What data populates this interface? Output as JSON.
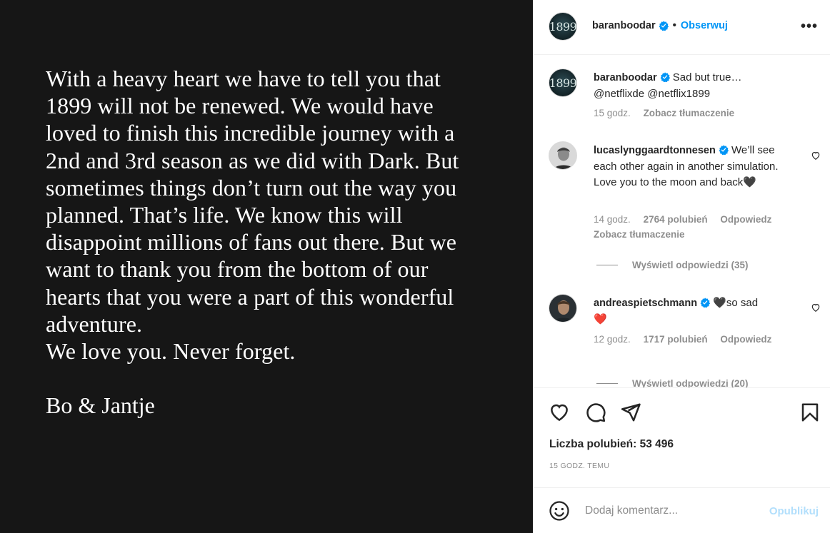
{
  "post": {
    "letter_lines": [
      "With a heavy heart we have to tell you that",
      "1899 will not be renewed. We would have",
      "loved to finish this incredible journey with a",
      "2nd and 3rd season as we did with Dark. But",
      "sometimes things don’t turn out the way you",
      "planned. That’s life. We know this will",
      "disappoint millions of fans out there. But we",
      "want to thank you from the bottom of our",
      "hearts that you were a part of this wonderful",
      "adventure.",
      "We love you. Never forget."
    ],
    "signature": "Bo & Jantje"
  },
  "header": {
    "avatar_text": "1899",
    "username": "baranboodar",
    "follow_label": "Obserwuj",
    "separator": "•",
    "more_label": "•••"
  },
  "caption": {
    "username": "baranboodar",
    "text": "Sad but true…",
    "mentions": "@netflixde @netflix1899",
    "time": "15 godz.",
    "translate": "Zobacz tłumaczenie"
  },
  "comments": [
    {
      "username": "lucaslynggaardtonnesen",
      "text_line1": "We’ll",
      "text_rest": "see each other again in another simulation. Love you to the moon and back🖤",
      "time": "14 godz.",
      "likes": "2764 polubień",
      "reply": "Odpowiedz",
      "translate": "Zobacz tłumaczenie",
      "view_replies": "Wyświetl odpowiedzi (35)"
    },
    {
      "username": "andreaspietschmann",
      "text": "🖤so sad",
      "text_line2": "❤️",
      "time": "12 godz.",
      "likes": "1717 polubień",
      "reply": "Odpowiedz",
      "view_replies_partial": "Wyświetl odpowiedzi (20)"
    }
  ],
  "actions": {
    "likes_count": "Liczba polubień: 53 496",
    "time_ago": "15 GODZ. TEMU"
  },
  "add_comment": {
    "placeholder": "Dodaj komentarz...",
    "publish_label": "Opublikuj"
  },
  "colors": {
    "accent": "#0095f6",
    "publish_disabled": "#b2dffc",
    "muted": "#8e8e8e",
    "image_bg": "#161616"
  }
}
